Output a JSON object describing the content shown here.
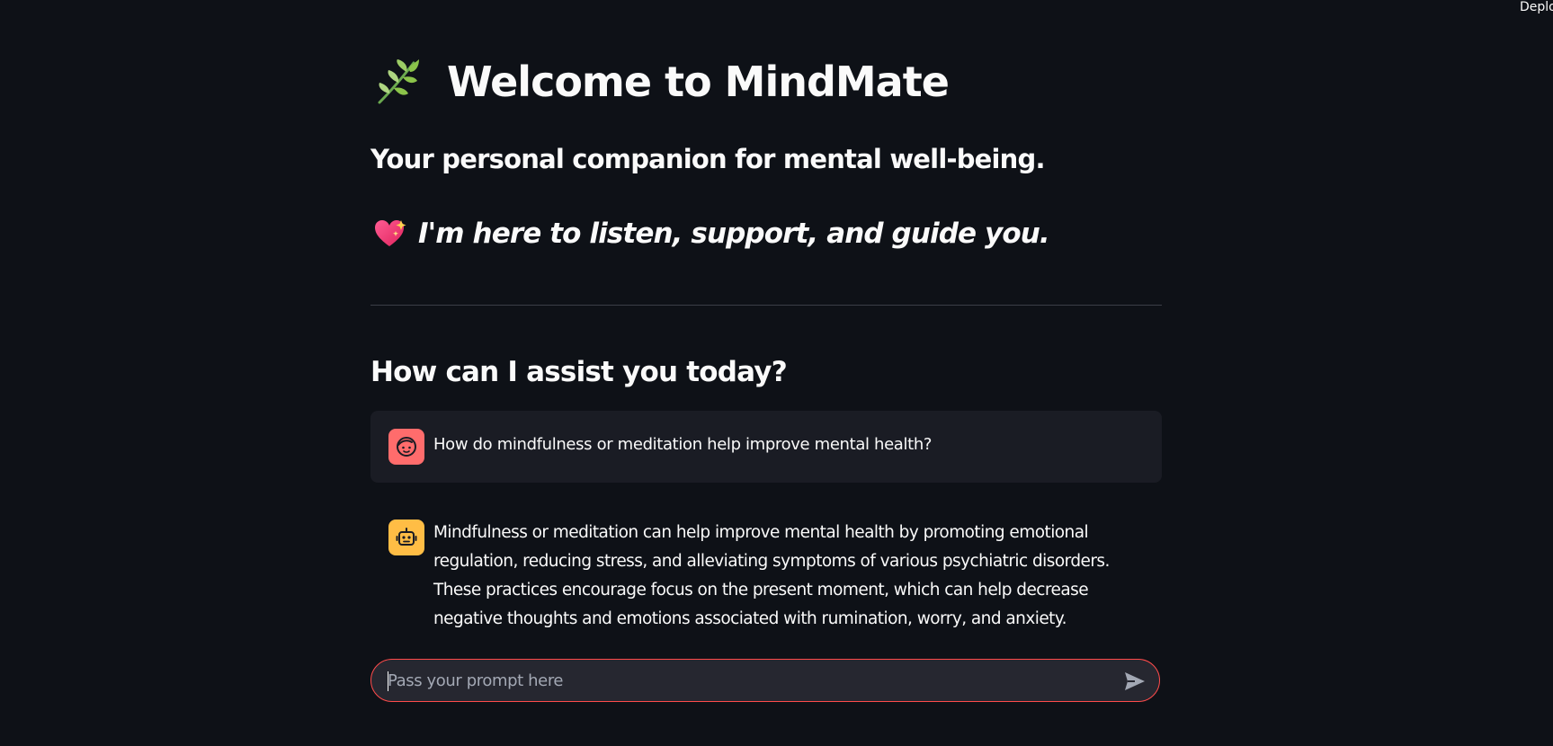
{
  "header": {
    "deploy_label": "Deploy"
  },
  "hero": {
    "icon": "herb-leaf-icon",
    "title": "Welcome to MindMate",
    "subtitle": "Your personal companion for mental well-being.",
    "tagline_icon": "sparkling-heart-icon",
    "tagline": "I'm here to listen, support, and guide you."
  },
  "chat": {
    "heading": "How can I assist you today?",
    "messages": [
      {
        "role": "user",
        "avatar_icon": "user-face-icon",
        "text": "How do mindfulness or meditation help improve mental health?"
      },
      {
        "role": "assistant",
        "avatar_icon": "robot-icon",
        "text": "Mindfulness or meditation can help improve mental health by promoting emotional regulation, reducing stress, and alleviating symptoms of various psychiatric disorders. These practices encourage focus on the present moment, which can help decrease negative thoughts and emotions associated with rumination, worry, and anxiety. Furthermore, mindfulness has been"
      }
    ],
    "input": {
      "placeholder": "Pass your prompt here",
      "value": "",
      "send_icon": "send-arrow-icon"
    }
  },
  "colors": {
    "background": "#0e1117",
    "user_avatar": "#ff6c6c",
    "bot_avatar": "#ffbd45",
    "user_message_bg": "#1a1c24",
    "input_border_focus": "#ff4b4b"
  }
}
